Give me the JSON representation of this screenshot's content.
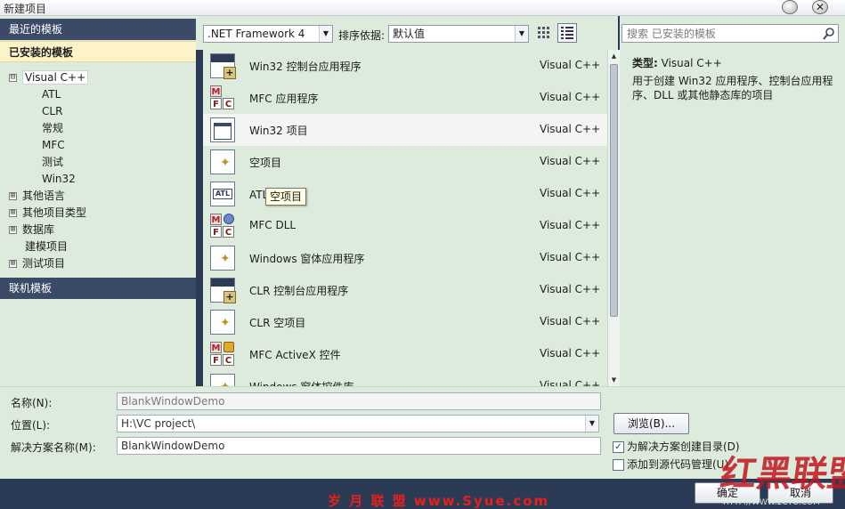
{
  "window": {
    "title": "新建项目",
    "close_glyph": "✕"
  },
  "left": {
    "recent_templates": "最近的模板",
    "installed_templates": "已安装的模板",
    "online_templates": "联机模板",
    "tree": [
      {
        "label": "Visual C++",
        "toggle": "⊟"
      },
      {
        "label": "ATL"
      },
      {
        "label": "CLR"
      },
      {
        "label": "常规"
      },
      {
        "label": "MFC"
      },
      {
        "label": "测试"
      },
      {
        "label": "Win32"
      },
      {
        "label": "其他语言",
        "toggle": "⊞"
      },
      {
        "label": "其他项目类型",
        "toggle": "⊞"
      },
      {
        "label": "数据库",
        "toggle": "⊞"
      },
      {
        "label": "建模项目"
      },
      {
        "label": "测试项目",
        "toggle": "⊞"
      }
    ]
  },
  "toolbar": {
    "framework": ".NET Framework 4",
    "sort_label": "排序依据:",
    "sort_value": "默认值",
    "dropdown_glyph": "▼"
  },
  "templates": [
    {
      "name": "Win32 控制台应用程序",
      "lang": "Visual C++",
      "icon": "console-icon"
    },
    {
      "name": "MFC 应用程序",
      "lang": "Visual C++",
      "icon": "mfc-icon"
    },
    {
      "name": "Win32 项目",
      "lang": "Visual C++",
      "icon": "window-icon"
    },
    {
      "name": "空项目",
      "lang": "Visual C++",
      "icon": "empty-project-icon"
    },
    {
      "name": "ATL 项目",
      "lang": "Visual C++",
      "icon": "atl-icon"
    },
    {
      "name": "MFC DLL",
      "lang": "Visual C++",
      "icon": "mfc-dll-icon"
    },
    {
      "name": "Windows 窗体应用程序",
      "lang": "Visual C++",
      "icon": "forms-icon"
    },
    {
      "name": "CLR 控制台应用程序",
      "lang": "Visual C++",
      "icon": "console-icon"
    },
    {
      "name": "CLR 空项目",
      "lang": "Visual C++",
      "icon": "empty-project-icon"
    },
    {
      "name": "MFC ActiveX 控件",
      "lang": "Visual C++",
      "icon": "mfc-activex-icon"
    },
    {
      "name": "Windows 窗体控件库",
      "lang": "Visual C++",
      "icon": "forms-icon"
    }
  ],
  "tooltip": "空项目",
  "right": {
    "search_placeholder": "搜索 已安装的模板",
    "type_label": "类型:",
    "type_value": "Visual C++",
    "description": "用于创建 Win32 应用程序、控制台应用程序、DLL 或其他静态库的项目"
  },
  "form": {
    "name_label": "名称(N):",
    "name_value": "BlankWindowDemo",
    "location_label": "位置(L):",
    "location_value": "H:\\VC project\\",
    "solution_label": "解决方案名称(M):",
    "solution_value": "BlankWindowDemo",
    "browse_label": "浏览(B)...",
    "create_dir_label": "为解决方案创建目录(D)",
    "create_dir_checked": true,
    "check_glyph": "✓",
    "source_control_label": "添加到源代码管理(U)",
    "source_control_checked": false,
    "ok_label": "确定",
    "cancel_label": "取消"
  },
  "watermark": {
    "site_text": "岁 月 联 盟  www.Syue.com",
    "logo_text": "红黑联盟",
    "url_text": "HTTP://WWW.2CTO.COM"
  },
  "colors": {
    "panel_bg": "#dcebdc",
    "header_dark": "#3a4a67",
    "header_active": "#fdf3c8",
    "window_frame": "#2b3a55",
    "watermark_red": "#e8201a"
  }
}
